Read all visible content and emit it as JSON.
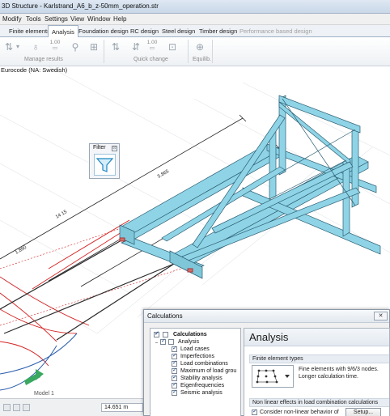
{
  "window": {
    "title": "3D Structure - Karlstrand_A6_b_z-50mm_operation.str"
  },
  "menu": [
    "Modify",
    "Tools",
    "Settings",
    "View",
    "Window",
    "Help"
  ],
  "tabs": [
    {
      "label": "Finite elements",
      "state": "normal"
    },
    {
      "label": "Analysis",
      "state": "active"
    },
    {
      "label": "Foundation design",
      "state": "normal"
    },
    {
      "label": "RC design",
      "state": "normal"
    },
    {
      "label": "Steel design",
      "state": "normal"
    },
    {
      "label": "Timber design",
      "state": "normal"
    },
    {
      "label": "Performance based design",
      "state": "disabled"
    }
  ],
  "ribbon": {
    "groups": [
      "Manage results",
      "Quick change",
      "Equilib."
    ],
    "number_a": "1.00",
    "number_b": "1.00"
  },
  "viewport": {
    "standard": "Eurocode (NA: Swedish)",
    "dimension_labels": [
      "14 15",
      "5.865",
      "1.890"
    ],
    "filter": {
      "label": "Filter"
    },
    "model_tab": "Model 1",
    "coordinate": "14.651 m",
    "colors": {
      "member": "#8fd4e6",
      "member_edge": "#2c5f74",
      "load_line": "#d42020",
      "dim_line": "#222222"
    }
  },
  "calculations_dialog": {
    "title": "Calculations",
    "tree": [
      {
        "label": "Calculations",
        "checked": true,
        "level": 0,
        "bold": true
      },
      {
        "label": "Analysis",
        "checked": true,
        "level": 1,
        "bold": false
      },
      {
        "label": "Load cases",
        "checked": true,
        "level": 2,
        "bold": false
      },
      {
        "label": "Imperfections",
        "checked": true,
        "level": 2,
        "bold": false
      },
      {
        "label": "Load combinations",
        "checked": true,
        "level": 2,
        "bold": false
      },
      {
        "label": "Maximum of load grou",
        "checked": true,
        "level": 2,
        "bold": false
      },
      {
        "label": "Stability analysis",
        "checked": true,
        "level": 2,
        "bold": false
      },
      {
        "label": "Eigenfrequencies",
        "checked": true,
        "level": 2,
        "bold": false
      },
      {
        "label": "Seismic analysis",
        "checked": true,
        "level": 2,
        "bold": false
      }
    ],
    "panel_title": "Analysis",
    "fe_section": "Finite element types",
    "fe_text": "Fine elements with 9/6/3 nodes. Longer calculation time.",
    "nl_section": "Non linear effects in load combination calculations",
    "nl_option": "Consider non-linear behavior of",
    "nl_checked": true,
    "setup_label": "Setup..."
  }
}
